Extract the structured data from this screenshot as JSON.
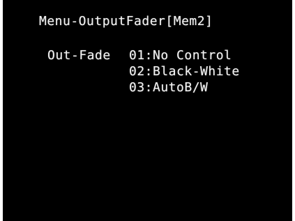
{
  "menu": {
    "title": "Menu-OutputFader[Mem2]",
    "parameter_label": "Out-Fade",
    "options": [
      {
        "label": "01:No Control"
      },
      {
        "label": "02:Black-White"
      },
      {
        "label": "03:AutoB/W"
      }
    ]
  },
  "colors": {
    "background": "#000000",
    "text": "#f2f2f2",
    "frame": "#ffffff"
  }
}
